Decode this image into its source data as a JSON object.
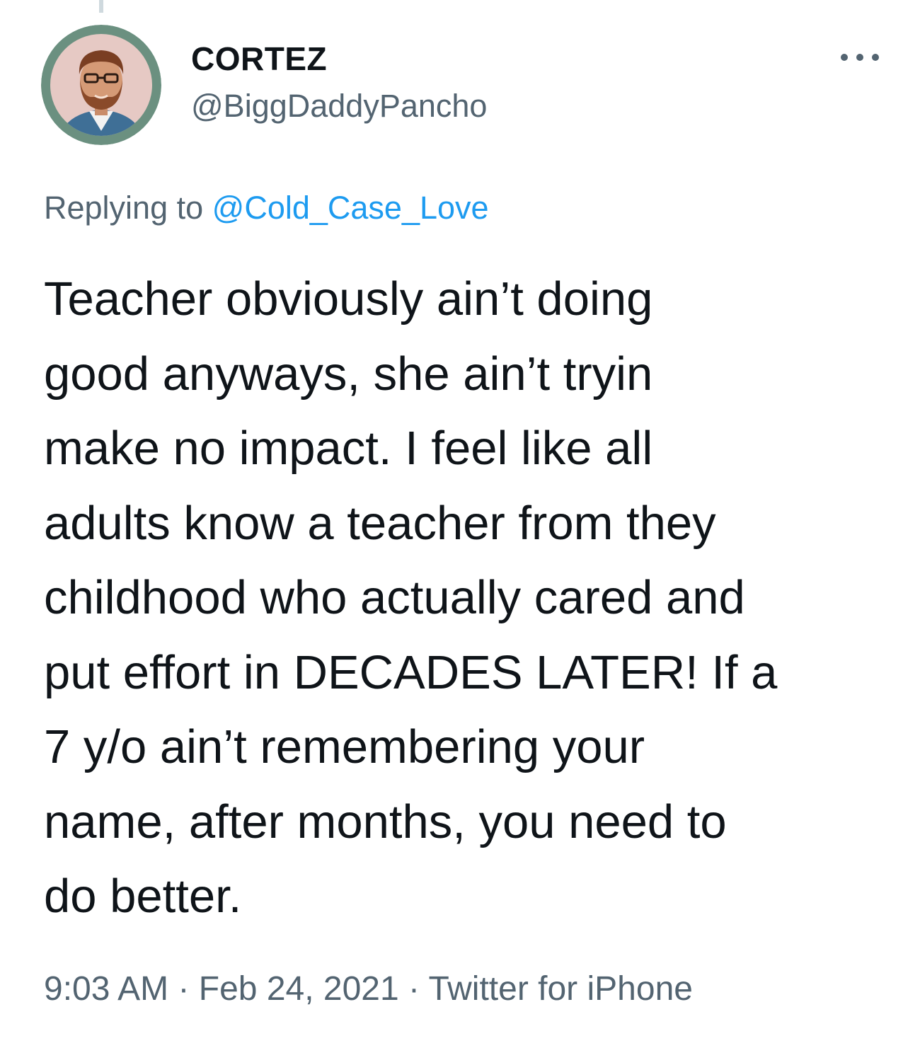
{
  "tweet": {
    "display_name": "CORTEZ",
    "handle": "@BiggDaddyPancho",
    "avatar_icon": "user-avatar-cartoon-bearded-man",
    "more_icon": "more-options-icon",
    "reply_prefix": "Replying to ",
    "reply_to": "@Cold_Case_Love",
    "text_lines": [
      "Teacher obviously ain’t doing",
      "good anyways, she ain’t tryin",
      "make no impact. I feel like all",
      "adults know a teacher from they",
      "childhood who actually cared and",
      "put effort in DECADES LATER! If a",
      "7 y/o ain’t remembering your",
      "name, after months, you need to",
      "do better."
    ],
    "time": "9:03 AM",
    "separator": " · ",
    "date": "Feb 24, 2021",
    "source": "Twitter for iPhone"
  },
  "colors": {
    "text": "#0f1419",
    "secondary": "#536471",
    "link": "#1d9bf0",
    "avatar_ring": "#6b9080",
    "avatar_bg": "#e6c9c4"
  }
}
